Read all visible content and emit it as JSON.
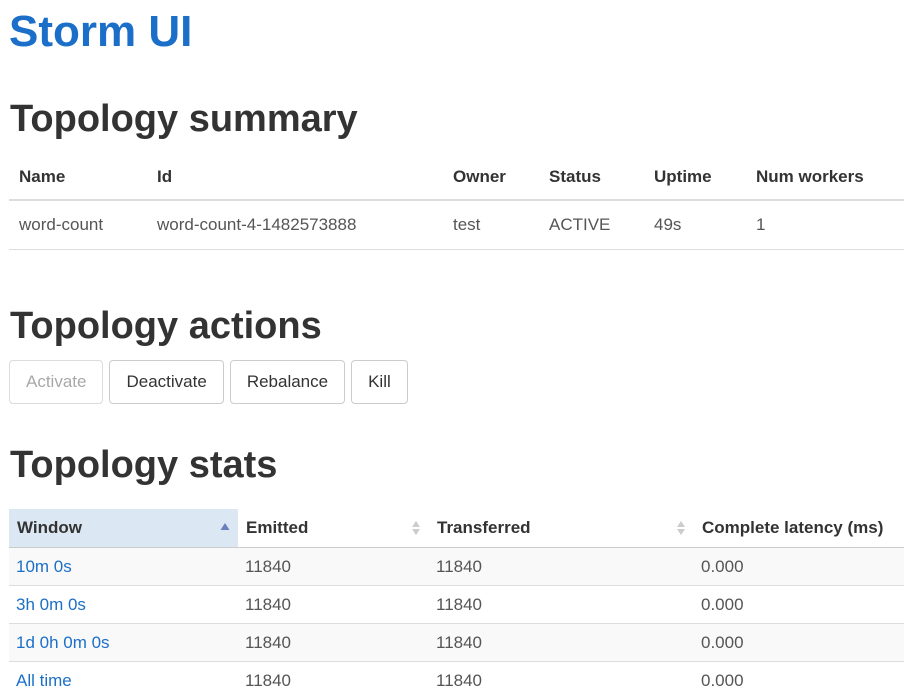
{
  "app": {
    "title": "Storm UI"
  },
  "topology_summary": {
    "heading": "Topology summary",
    "columns": [
      "Name",
      "Id",
      "Owner",
      "Status",
      "Uptime",
      "Num workers"
    ],
    "row": {
      "name": "word-count",
      "id": "word-count-4-1482573888",
      "owner": "test",
      "status": "ACTIVE",
      "uptime": "49s",
      "num_workers": "1"
    }
  },
  "topology_actions": {
    "heading": "Topology actions",
    "buttons": [
      {
        "label": "Activate",
        "enabled": false
      },
      {
        "label": "Deactivate",
        "enabled": true
      },
      {
        "label": "Rebalance",
        "enabled": true
      },
      {
        "label": "Kill",
        "enabled": true
      }
    ]
  },
  "topology_stats": {
    "heading": "Topology stats",
    "columns": [
      "Window",
      "Emitted",
      "Transferred",
      "Complete latency (ms)"
    ],
    "sorted_column": "Window",
    "sort_direction": "ascending",
    "rows": [
      {
        "window": "10m 0s",
        "emitted": "11840",
        "transferred": "11840",
        "complete_latency": "0.000"
      },
      {
        "window": "3h 0m 0s",
        "emitted": "11840",
        "transferred": "11840",
        "complete_latency": "0.000"
      },
      {
        "window": "1d 0h 0m 0s",
        "emitted": "11840",
        "transferred": "11840",
        "complete_latency": "0.000"
      },
      {
        "window": "All time",
        "emitted": "11840",
        "transferred": "11840",
        "complete_latency": "0.000"
      }
    ]
  },
  "colors": {
    "brand_link": "#1c6fc8",
    "heading_text": "#333333",
    "sorted_header_bg": "#dbe7f3",
    "sort_asc_arrow": "#6b7fc0",
    "sort_inactive_arrow": "#cccccc"
  },
  "icons": {
    "sort_ascending": "triangle-up-icon",
    "sort_unsorted": "up-down-arrows-icon"
  }
}
